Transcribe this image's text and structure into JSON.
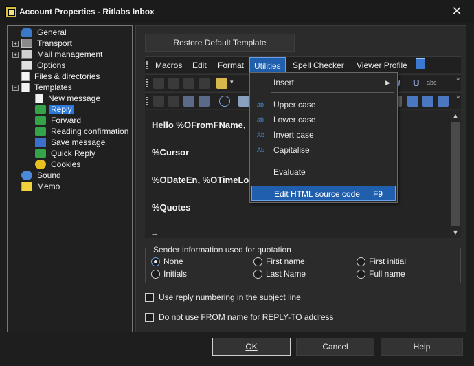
{
  "window": {
    "title": "Account Properties - Ritlabs Inbox"
  },
  "tree": {
    "items": [
      {
        "label": "General",
        "icon": "person-icon"
      },
      {
        "label": "Transport",
        "icon": "transport-icon"
      },
      {
        "label": "Mail management",
        "icon": "mail-management-icon"
      },
      {
        "label": "Options",
        "icon": "options-icon"
      },
      {
        "label": "Files & directories",
        "icon": "files-icon"
      },
      {
        "label": "Templates",
        "icon": "templates-icon"
      },
      {
        "label": "New message",
        "icon": "new-message-icon"
      },
      {
        "label": "Reply",
        "icon": "reply-icon",
        "selected": true
      },
      {
        "label": "Forward",
        "icon": "forward-icon"
      },
      {
        "label": "Reading confirmation",
        "icon": "reading-confirmation-icon"
      },
      {
        "label": "Save message",
        "icon": "save-message-icon"
      },
      {
        "label": "Quick Reply",
        "icon": "quick-reply-icon"
      },
      {
        "label": "Cookies",
        "icon": "cookies-icon"
      },
      {
        "label": "Sound",
        "icon": "sound-icon"
      },
      {
        "label": "Memo",
        "icon": "memo-icon"
      }
    ]
  },
  "restore_button": {
    "label": "Restore Default Template"
  },
  "menubar": {
    "items": [
      "Macros",
      "Edit",
      "Format",
      "Utilities",
      "Spell Checker",
      "Viewer Profile"
    ],
    "active": "Utilities"
  },
  "dropdown": {
    "insert": "Insert",
    "upper_case": "Upper case",
    "lower_case": "Lower case",
    "invert_case": "Invert case",
    "capitalise": "Capitalise",
    "evaluate": "Evaluate",
    "edit_html": "Edit HTML source code",
    "edit_html_shortcut": "F9"
  },
  "editor": {
    "line1": "Hello %OFromFName,",
    "line2": "%Cursor",
    "line3": "%ODateEn, %OTimeLo",
    "line4": "%Quotes",
    "line5": "--"
  },
  "sender_group": {
    "title": "Sender information used for quotation",
    "options": [
      "None",
      "Initials",
      "First name",
      "Last Name",
      "First initial",
      "Full name"
    ],
    "selected": "None"
  },
  "checkboxes": {
    "reply_numbering": "Use reply numbering in the subject line",
    "no_from_name": "Do not use FROM name for REPLY-TO address"
  },
  "buttons": {
    "ok": "OK",
    "cancel": "Cancel",
    "help": "Help"
  },
  "colors": {
    "accent": "#1f5fae",
    "selection": "#2b78d8"
  }
}
